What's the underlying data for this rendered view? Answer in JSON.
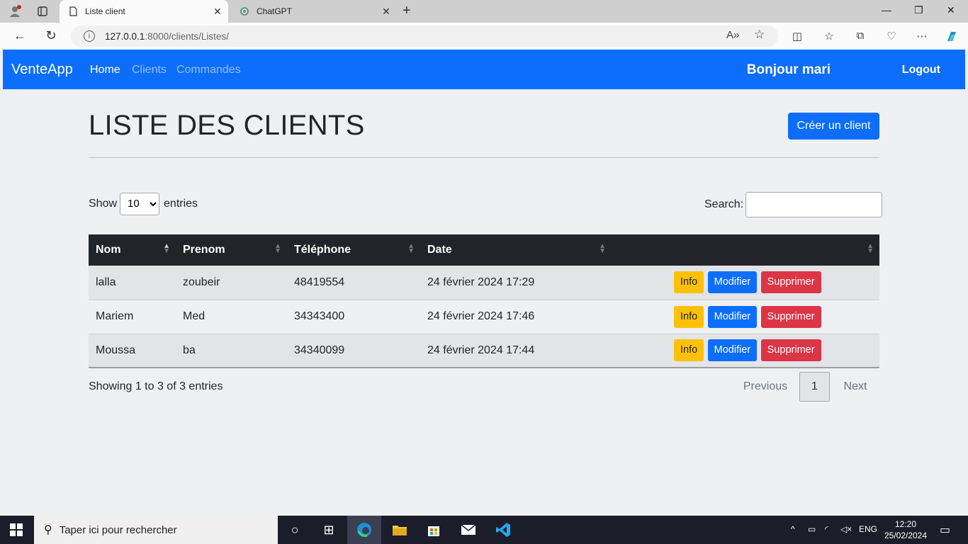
{
  "browser": {
    "tabs": [
      {
        "title": "Liste client",
        "active": true
      },
      {
        "title": "ChatGPT",
        "active": false
      }
    ],
    "url_host": "127.0.0.1",
    "url_path": ":8000/clients/Listes/"
  },
  "navbar": {
    "brand": "VenteApp",
    "links": [
      "Home",
      "Clients",
      "Commandes"
    ],
    "greeting": "Bonjour mari",
    "logout": "Logout"
  },
  "page": {
    "title": "LISTE DES CLIENTS",
    "create_button": "Créer un client"
  },
  "datatable": {
    "show_label": "Show",
    "entries_label": "entries",
    "page_length": "10",
    "search_label": "Search:",
    "columns": [
      "Nom",
      "Prenom",
      "Téléphone",
      "Date",
      ""
    ],
    "rows": [
      {
        "nom": "lalla",
        "prenom": "zoubeir",
        "telephone": "48419554",
        "date": "24 février 2024 17:29"
      },
      {
        "nom": "Mariem",
        "prenom": "Med",
        "telephone": "34343400",
        "date": "24 février 2024 17:46"
      },
      {
        "nom": "Moussa",
        "prenom": "ba",
        "telephone": "34340099",
        "date": "24 février 2024 17:44"
      }
    ],
    "actions": {
      "info": "Info",
      "modify": "Modifier",
      "delete": "Supprimer"
    },
    "info_text": "Showing 1 to 3 of 3 entries",
    "pagination": {
      "previous": "Previous",
      "current": "1",
      "next": "Next"
    }
  },
  "taskbar": {
    "search_placeholder": "Taper ici pour rechercher",
    "language": "ENG",
    "time": "12:20",
    "date": "25/02/2024"
  },
  "colors": {
    "primary": "#0d6efd",
    "warning": "#ffc107",
    "danger": "#dc3545",
    "dark": "#212529"
  }
}
